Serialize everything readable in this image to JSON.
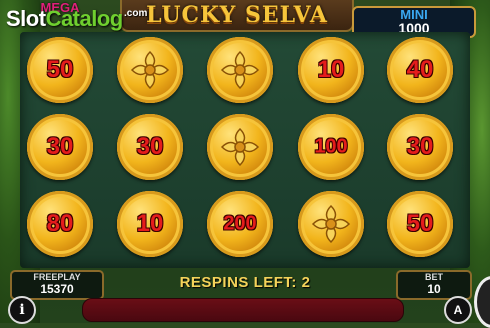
{
  "brand": {
    "name_slot": "Slot",
    "name_catalog": "Catalog",
    "com": ".com"
  },
  "game": {
    "title": "LUCKY SELVA"
  },
  "jackpots": {
    "mega": {
      "label": "MEGA"
    },
    "mini": {
      "label": "MINI",
      "value": "1000"
    }
  },
  "grid": {
    "rows": [
      [
        "50",
        "symbol",
        "symbol",
        "10",
        "40"
      ],
      [
        "30",
        "30",
        "symbol",
        "100",
        "30"
      ],
      [
        "80",
        "10",
        "200",
        "symbol",
        "50"
      ]
    ]
  },
  "status": {
    "respins": "RESPINS LEFT: 2"
  },
  "freeplay": {
    "label": "FREEPLAY",
    "value": "15370"
  },
  "bet": {
    "label": "BET",
    "value": "10"
  },
  "buttons": {
    "info": "i",
    "auto": "A"
  },
  "colors": {
    "coin": "#f2b51c",
    "number": "#e51c1c",
    "respins": "#f4d35a",
    "mini_label": "#3aa8f0",
    "mega_label": "#e0207a"
  }
}
